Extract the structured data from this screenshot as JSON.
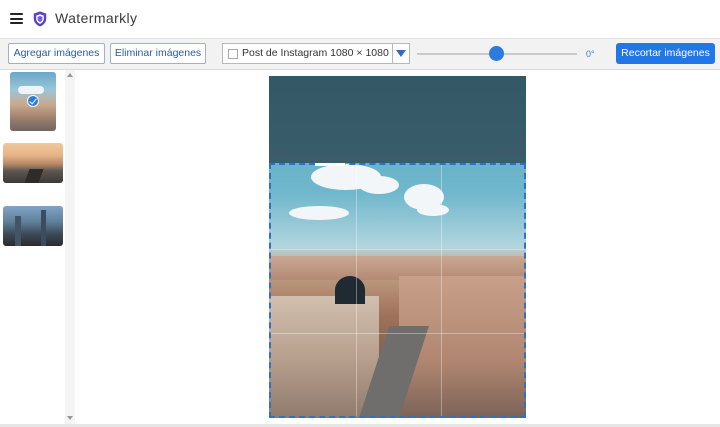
{
  "app": {
    "name": "Watermarkly",
    "accent_color": "#2277e8",
    "logo_color": "#5b3fc4"
  },
  "toolbar": {
    "add_images_label": "Agregar imágenes",
    "remove_images_label": "Eliminar imágenes",
    "preset": {
      "selected": "Post de Instagram 1080 × 1080",
      "checked": false
    },
    "rotation": {
      "value_label": "0°",
      "slider_position": 0.5
    },
    "crop_images_label": "Recortar imágenes"
  },
  "sidebar": {
    "thumbnails": [
      {
        "id": "city-aerial",
        "selected": true,
        "icon": "check-icon"
      },
      {
        "id": "desert-road",
        "selected": false
      },
      {
        "id": "city-skyline",
        "selected": false
      }
    ]
  },
  "editor": {
    "crop_aspect": "1:1",
    "crop_color": "#2e6fd6"
  }
}
